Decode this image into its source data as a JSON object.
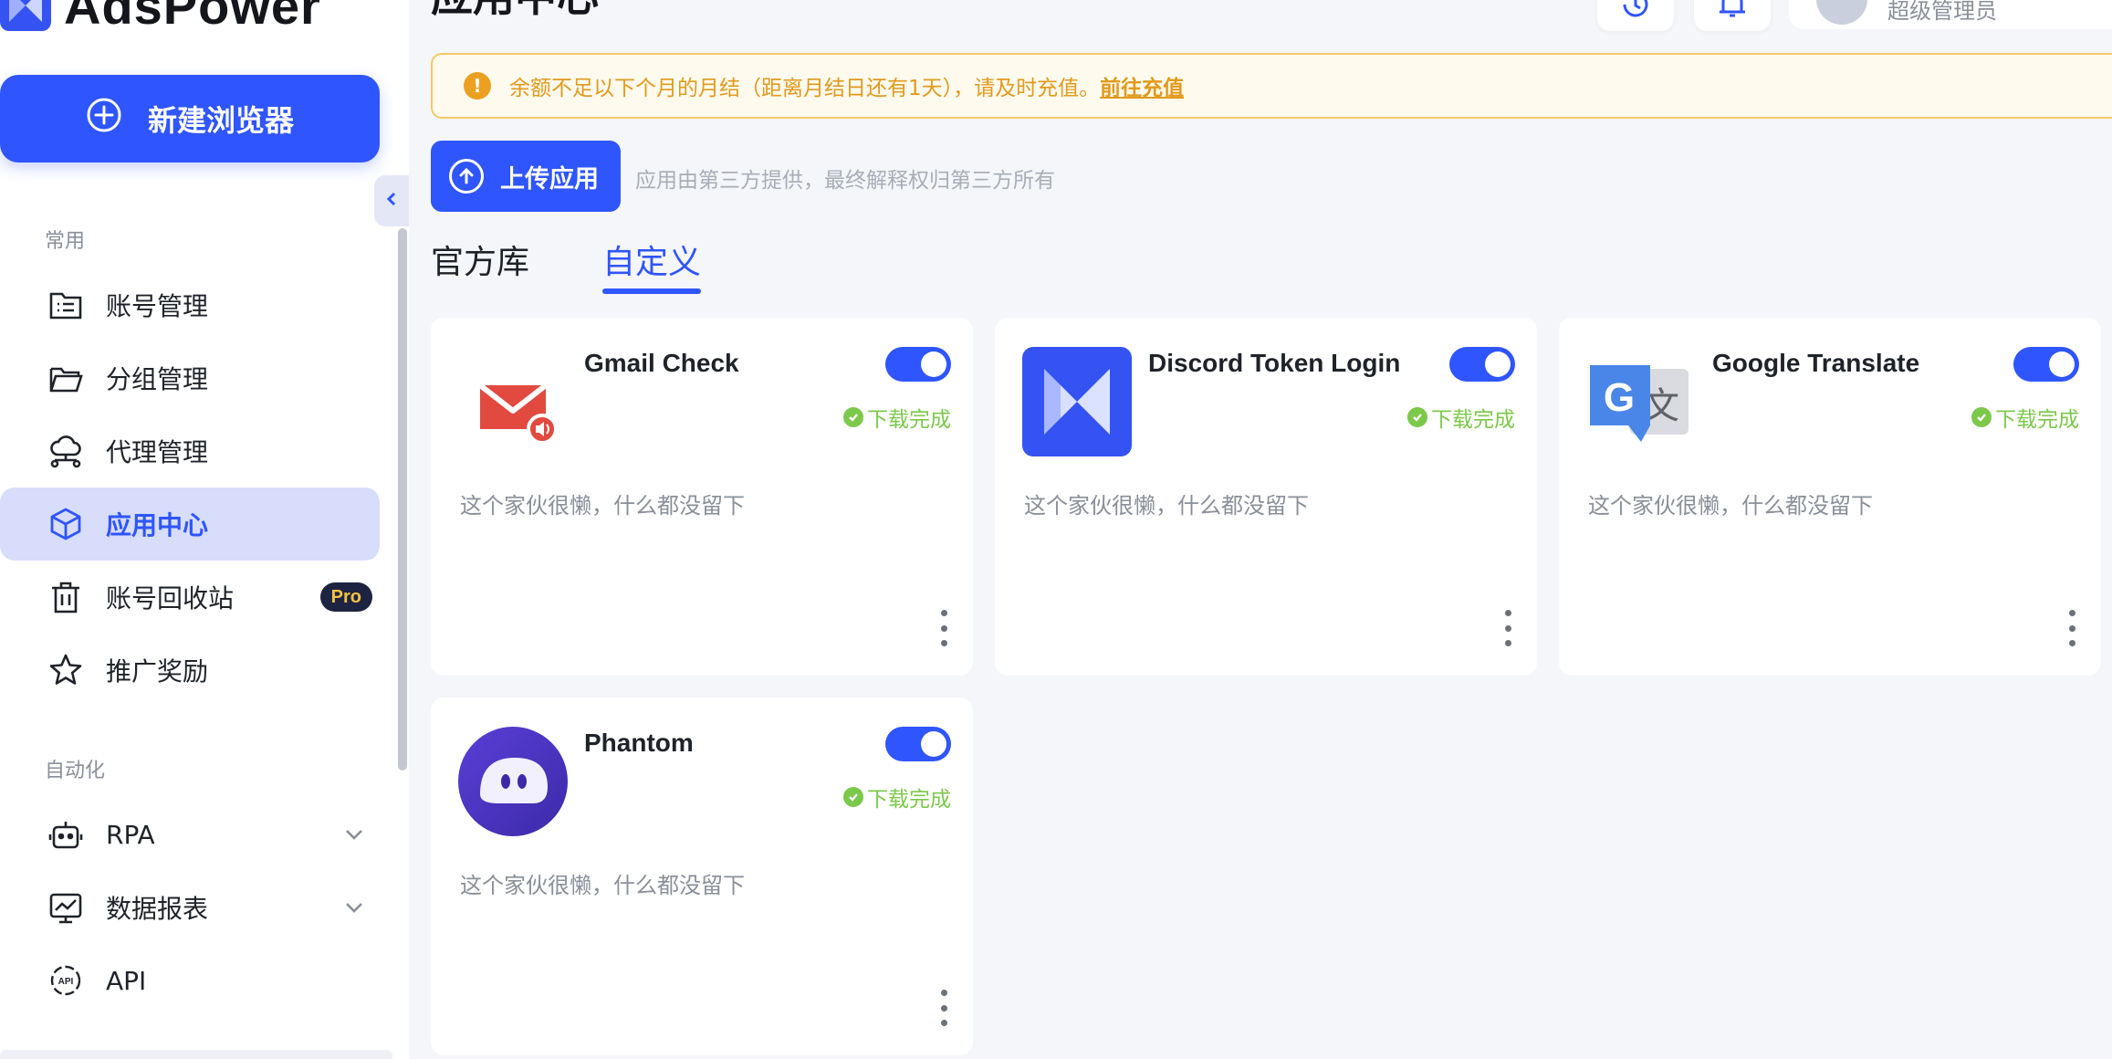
{
  "app": {
    "name": "AdsPower"
  },
  "sidebar": {
    "new_browser_label": "新建浏览器",
    "section_common": "常用",
    "section_automation": "自动化",
    "items": [
      {
        "label": "账号管理",
        "icon": "list-folder-icon"
      },
      {
        "label": "分组管理",
        "icon": "folder-open-icon"
      },
      {
        "label": "代理管理",
        "icon": "cloud-network-icon"
      },
      {
        "label": "应用中心",
        "icon": "cube-icon",
        "active": true
      },
      {
        "label": "账号回收站",
        "icon": "trash-icon",
        "badge": "Pro"
      },
      {
        "label": "推广奖励",
        "icon": "star-icon"
      }
    ],
    "automation_items": [
      {
        "label": "RPA",
        "icon": "robot-icon"
      },
      {
        "label": "数据报表",
        "icon": "chart-monitor-icon"
      },
      {
        "label": "API",
        "icon": "api-icon"
      }
    ]
  },
  "header": {
    "title": "应用中心",
    "user_role": "超级管理员"
  },
  "notice": {
    "text": "余额不足以下个月的月结（距离月结日还有1天），请及时充值。",
    "link": "前往充值"
  },
  "upload": {
    "button_label": "上传应用",
    "hint": "应用由第三方提供，最终解释权归第三方所有"
  },
  "tabs": [
    {
      "label": "官方库",
      "active": false
    },
    {
      "label": "自定义",
      "active": true
    }
  ],
  "apps": [
    {
      "name": "Gmail Check",
      "status": "下载完成",
      "description": "这个家伙很懒，什么都没留下",
      "enabled": true
    },
    {
      "name": "Discord Token Login",
      "status": "下载完成",
      "description": "这个家伙很懒，什么都没留下",
      "enabled": true
    },
    {
      "name": "Google Translate",
      "status": "下载完成",
      "description": "这个家伙很懒，什么都没留下",
      "enabled": true
    },
    {
      "name": "Phantom",
      "status": "下载完成",
      "description": "这个家伙很懒，什么都没留下",
      "enabled": true
    }
  ],
  "colors": {
    "primary": "#2f55ff",
    "success": "#7cc84b",
    "warning": "#e19a1c"
  }
}
